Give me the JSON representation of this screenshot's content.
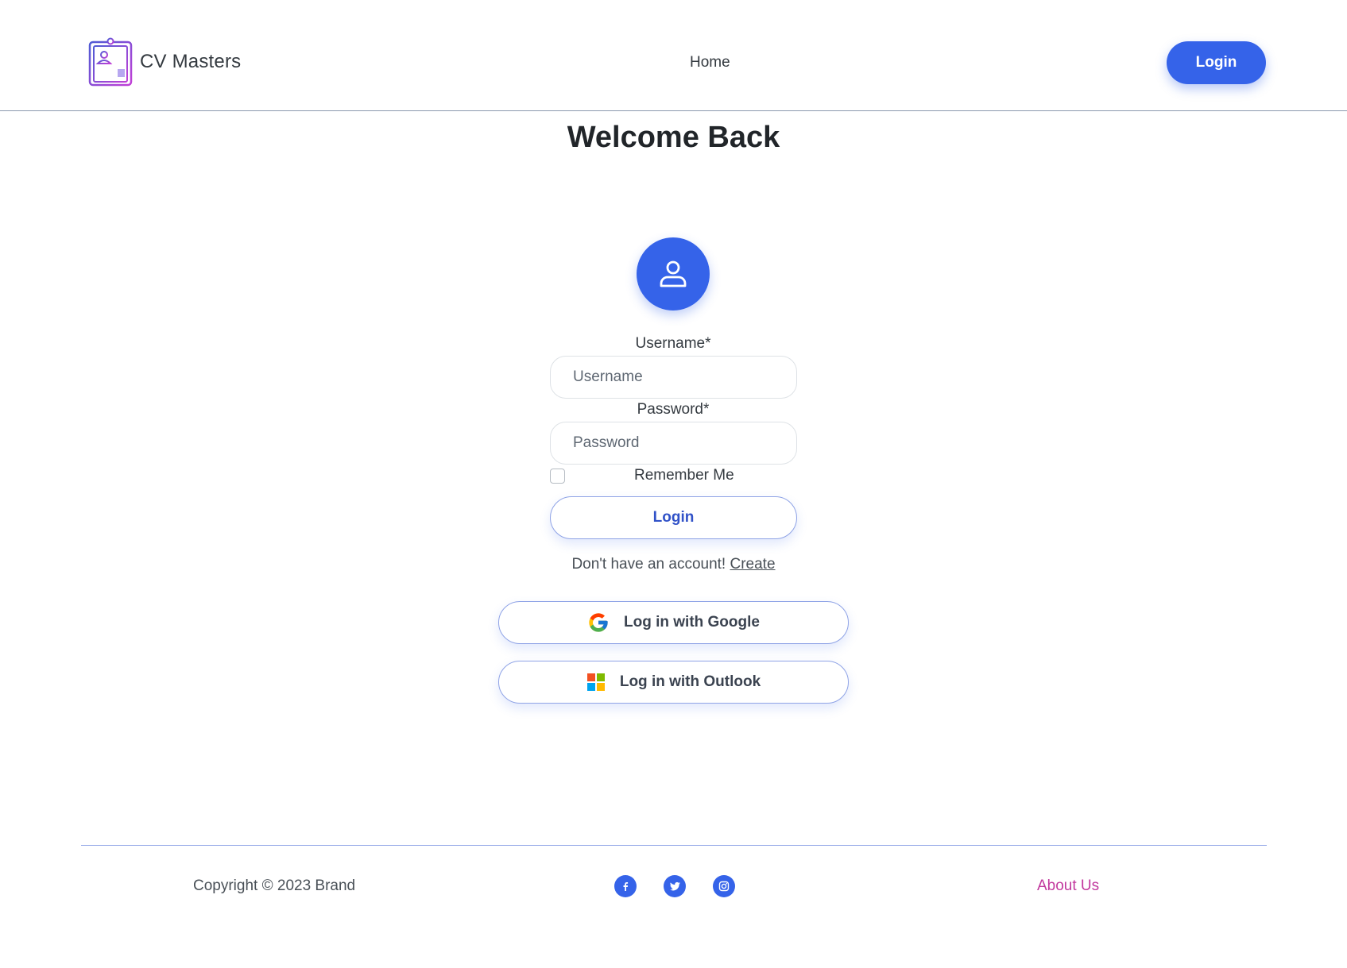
{
  "header": {
    "brand_name": "CV Masters",
    "nav_home": "Home",
    "login_button": "Login"
  },
  "main": {
    "title": "Welcome Back",
    "username_label": "Username*",
    "username_placeholder": "Username",
    "password_label": "Password*",
    "password_placeholder": "Password",
    "remember_me": "Remember Me",
    "remember_checked": false,
    "login_button": "Login",
    "signup_prompt": "Don't have an account!",
    "signup_link": "Create",
    "google_button": "Log in with Google",
    "outlook_button": "Log in with Outlook"
  },
  "footer": {
    "copyright": "Copyright © 2023 Brand",
    "social_icons": [
      "facebook-icon",
      "twitter-icon",
      "instagram-icon"
    ],
    "about_link": "About Us"
  },
  "colors": {
    "primary": "#3563e9",
    "about_link": "#c2399e",
    "border": "#8fa3e6"
  }
}
